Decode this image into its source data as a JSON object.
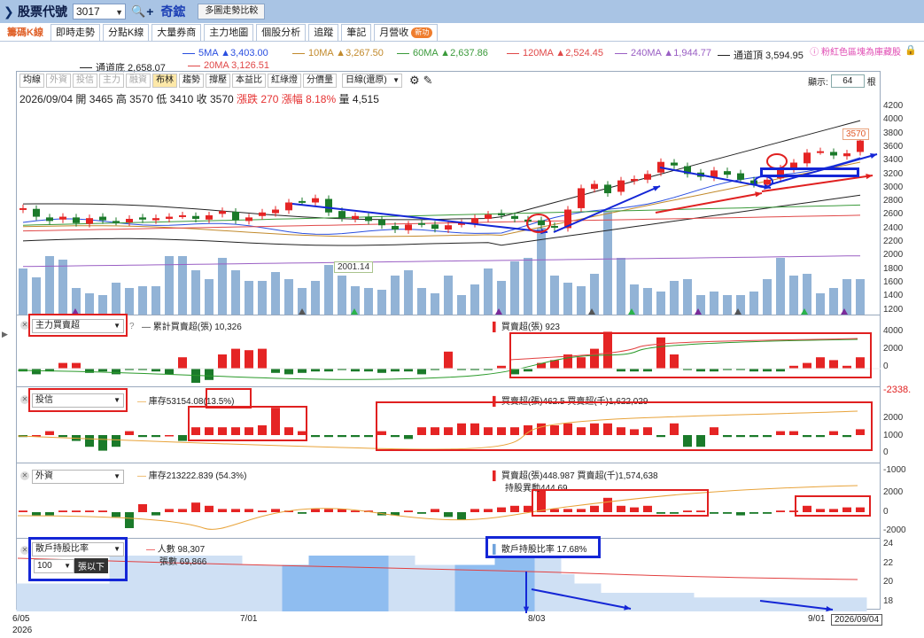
{
  "topbar": {
    "label": "股票代號",
    "code": "3017",
    "name": "奇鋐",
    "compare_button": "多圖走勢比較"
  },
  "tabs": [
    {
      "label": "籌碼K線",
      "active": true
    },
    {
      "label": "即時走勢"
    },
    {
      "label": "分點K線"
    },
    {
      "label": "大量券商"
    },
    {
      "label": "主力地圖"
    },
    {
      "label": "個股分析"
    },
    {
      "label": "追蹤"
    },
    {
      "label": "筆記"
    },
    {
      "label": "月營收",
      "badge": "新功"
    }
  ],
  "legend": {
    "ma5": "5MA ▲3,403.00",
    "ma10": "10MA ▲3,267.50",
    "ma60": "60MA ▲2,637.86",
    "ma120": "120MA ▲2,524.45",
    "ma240": "240MA ▲1,944.77",
    "channel_top": "通道頂 3,594.95",
    "channel_bottom": "通道底 2,658.07",
    "ma20": "20MA 3,126.51",
    "note": "粉紅色區塊為庫藏股",
    "colors": {
      "ma5": "#2a4fe0",
      "ma10": "#c28a2c",
      "ma60": "#3a9a3a",
      "ma120": "#e04848",
      "ma240": "#9a5fc4",
      "channel": "#222222",
      "ma20": "#e04848",
      "up": "#e52424",
      "down": "#1b7a2a",
      "volume": "#92b3d6"
    }
  },
  "toolbar": {
    "buttons": [
      "均線",
      "外資",
      "投信",
      "主力",
      "融資",
      "布林",
      "趨勢",
      "撐壓",
      "本益比",
      "紅綠燈",
      "分價量"
    ],
    "disabled": [
      "外資",
      "投信",
      "主力",
      "融資"
    ],
    "on": "布林",
    "period": "日線(還原)",
    "show_label": "顯示:",
    "show_count": "64",
    "show_unit": "根"
  },
  "ohlc": {
    "date": "2026/09/04",
    "open_label": "開",
    "open": "3465",
    "high_label": "高",
    "high": "3570",
    "low_label": "低",
    "low": "3410",
    "close_label": "收",
    "close": "3570",
    "chg_label": "漲跌",
    "chg": "270",
    "pct_label": "漲幅",
    "pct": "8.18%",
    "vol_label": "量",
    "vol": "4,515"
  },
  "price_axis": [
    "4200",
    "4000",
    "3800",
    "3600",
    "3400",
    "3200",
    "3000",
    "2800",
    "2600",
    "2400",
    "2200",
    "2000",
    "1800",
    "1600",
    "1400",
    "1200"
  ],
  "labels": {
    "last_price": "3570",
    "low_marker": "2001.14"
  },
  "panel1": {
    "select": "主力買賣超",
    "q": "?",
    "legend1": "累計買賣超(張) 10,326",
    "legend2": "買賣超(張) 923",
    "axis": [
      "4000",
      "2000",
      "0"
    ]
  },
  "panel2": {
    "select": "投信",
    "legend1": "庫存53154.08",
    "legend1b": "(13.5%)",
    "legend2": "買賣超(張)462.5 買賣超(千)1,622,029",
    "axis": [
      "2000",
      "1000",
      "0",
      "-1000"
    ],
    "neg": "-2338."
  },
  "panel3": {
    "select": "外資",
    "legend1": "庫存213222.839 (54.3%)",
    "legend2": "買賣超(張)448.987 買賣超(千)1,574,638",
    "legend3": "持股異動444.69",
    "axis": [
      "2000",
      "0",
      "-2000"
    ]
  },
  "panel4": {
    "select": "散戶持股比率",
    "sub_select": "100",
    "sub_label": "張以下",
    "legend1": "人數 98,307",
    "legend2": "張數 69,866",
    "legend3": "散戶持股比率 17.68%",
    "axis": [
      "24",
      "22",
      "20",
      "18"
    ]
  },
  "xaxis": {
    "d1": "6/05",
    "d1y": "2026",
    "d2": "7/01",
    "d3": "8/03",
    "d4": "9/01",
    "d5": "2026/09/04"
  }
}
